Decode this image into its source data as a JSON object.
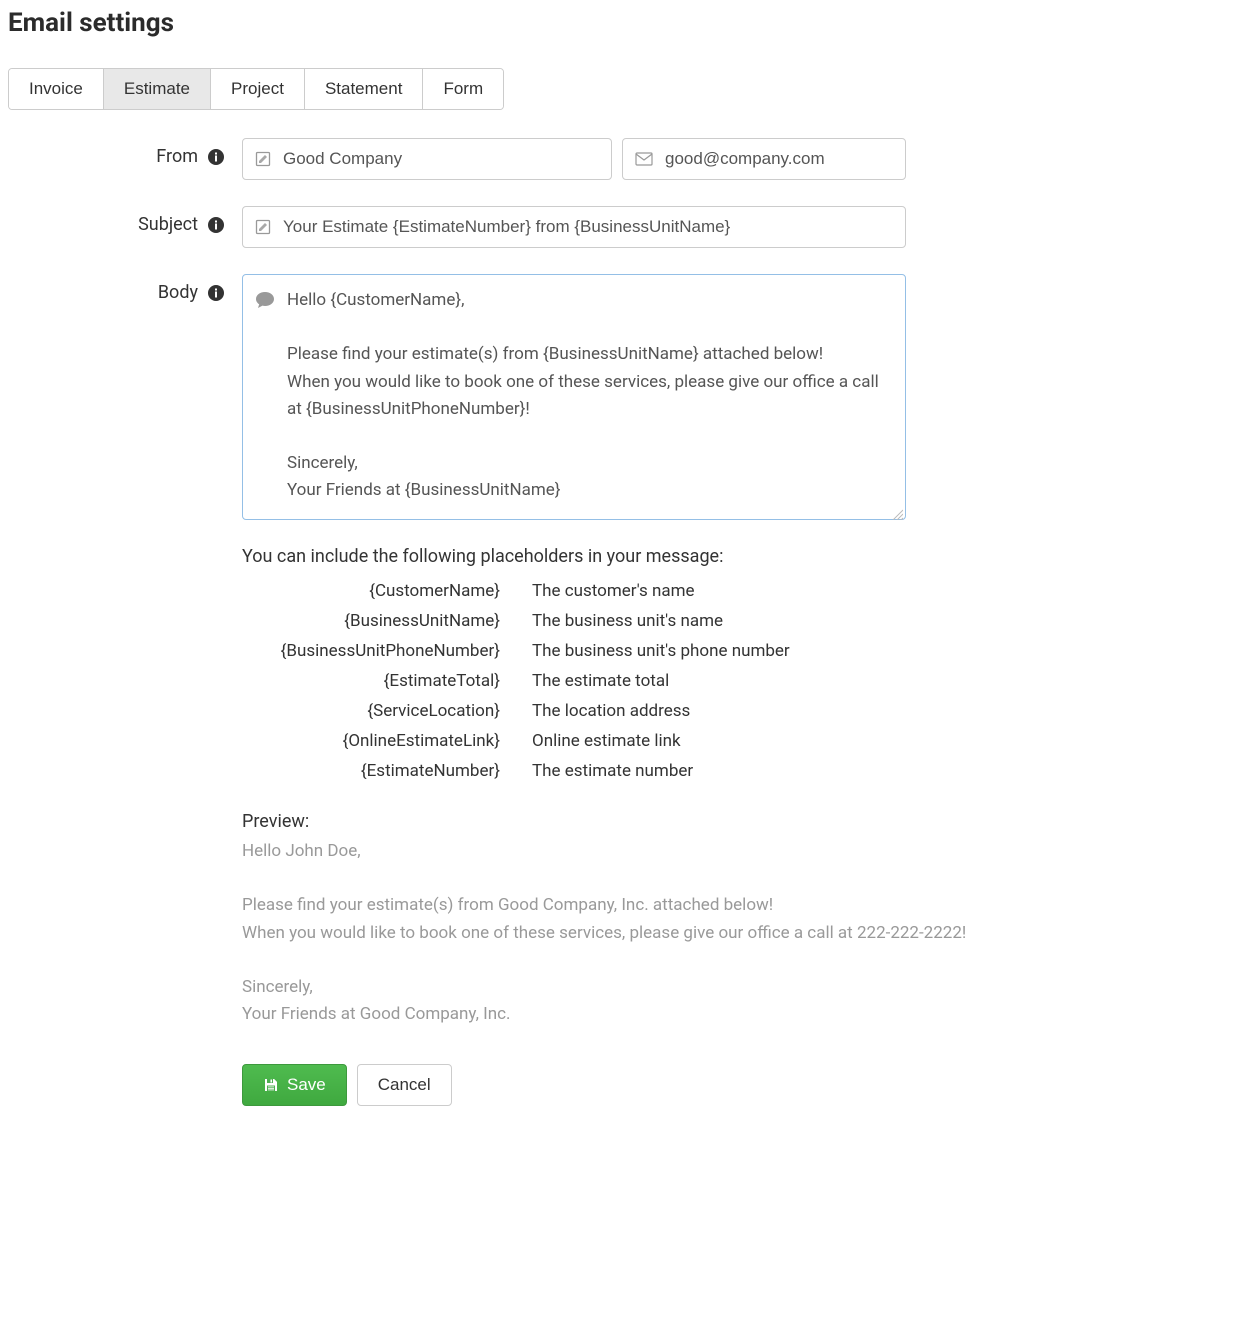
{
  "header": {
    "title": "Email settings"
  },
  "tabs": [
    {
      "label": "Invoice",
      "active": false
    },
    {
      "label": "Estimate",
      "active": true
    },
    {
      "label": "Project",
      "active": false
    },
    {
      "label": "Statement",
      "active": false
    },
    {
      "label": "Form",
      "active": false
    }
  ],
  "form": {
    "from": {
      "label": "From",
      "name_value": "Good Company",
      "email_value": "good@company.com"
    },
    "subject": {
      "label": "Subject",
      "value": "Your Estimate {EstimateNumber} from {BusinessUnitName}"
    },
    "body": {
      "label": "Body",
      "value": "Hello {CustomerName},\n\nPlease find your estimate(s) from {BusinessUnitName} attached below!\nWhen you would like to book one of these services, please give our office a call at {BusinessUnitPhoneNumber}!\n\nSincerely,\nYour Friends at {BusinessUnitName}"
    }
  },
  "placeholders": {
    "intro": "You can include the following placeholders in your message:",
    "items": [
      {
        "token": "{CustomerName}",
        "desc": "The customer's name"
      },
      {
        "token": "{BusinessUnitName}",
        "desc": "The business unit's name"
      },
      {
        "token": "{BusinessUnitPhoneNumber}",
        "desc": "The business unit's phone number"
      },
      {
        "token": "{EstimateTotal}",
        "desc": "The estimate total"
      },
      {
        "token": "{ServiceLocation}",
        "desc": "The location address"
      },
      {
        "token": "{OnlineEstimateLink}",
        "desc": "Online estimate link"
      },
      {
        "token": "{EstimateNumber}",
        "desc": "The estimate number"
      }
    ]
  },
  "preview": {
    "label": "Preview:",
    "text": "Hello John Doe,\n\nPlease find your estimate(s) from Good Company, Inc. attached below!\nWhen you would like to book one of these services, please give our office a call at 222-222-2222!\n\nSincerely,\nYour Friends at Good Company, Inc."
  },
  "buttons": {
    "save": "Save",
    "cancel": "Cancel"
  }
}
